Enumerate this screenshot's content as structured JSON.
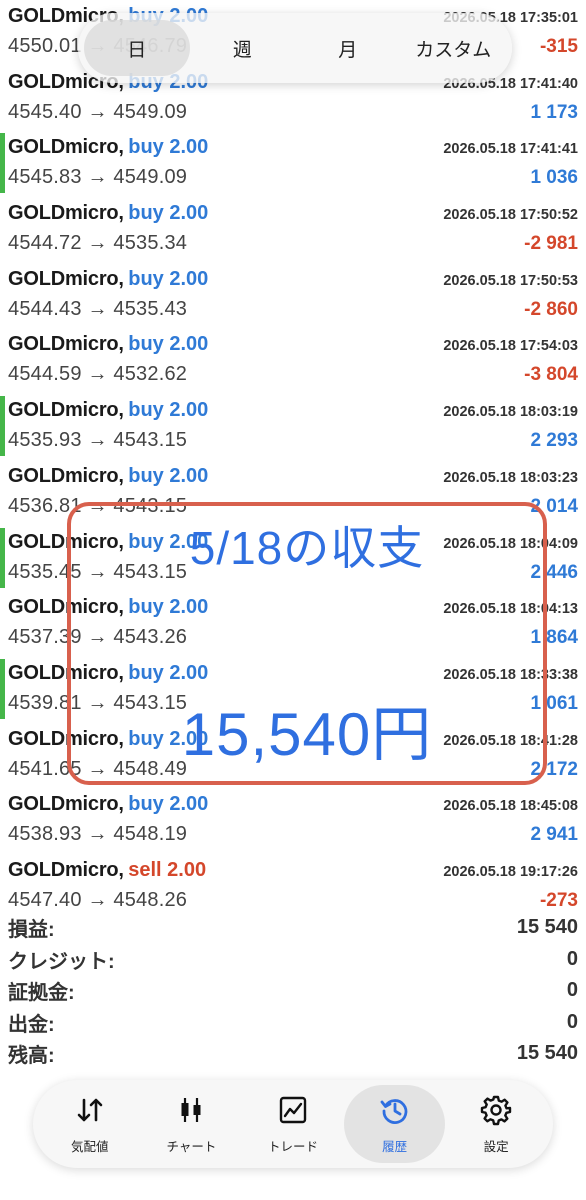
{
  "filter": {
    "tabs": [
      "日",
      "週",
      "月",
      "カスタム"
    ],
    "active_index": 0
  },
  "trades": [
    {
      "symbol": "GOLDmicro,",
      "side": "buy 2.00",
      "side_type": "buy",
      "time": "2026.05.18 17:35:01",
      "prices": "4550.01 → 4546.79",
      "profit": "-315",
      "profit_sign": "neg",
      "marked": false
    },
    {
      "symbol": "GOLDmicro,",
      "side": "buy 2.00",
      "side_type": "buy",
      "time": "2026.05.18 17:41:40",
      "prices": "4545.40 → 4549.09",
      "profit": "1 173",
      "profit_sign": "pos",
      "marked": false
    },
    {
      "symbol": "GOLDmicro,",
      "side": "buy 2.00",
      "side_type": "buy",
      "time": "2026.05.18 17:41:41",
      "prices": "4545.83 → 4549.09",
      "profit": "1 036",
      "profit_sign": "pos",
      "marked": true
    },
    {
      "symbol": "GOLDmicro,",
      "side": "buy 2.00",
      "side_type": "buy",
      "time": "2026.05.18 17:50:52",
      "prices": "4544.72 → 4535.34",
      "profit": "-2 981",
      "profit_sign": "neg",
      "marked": false
    },
    {
      "symbol": "GOLDmicro,",
      "side": "buy 2.00",
      "side_type": "buy",
      "time": "2026.05.18 17:50:53",
      "prices": "4544.43 → 4535.43",
      "profit": "-2 860",
      "profit_sign": "neg",
      "marked": false
    },
    {
      "symbol": "GOLDmicro,",
      "side": "buy 2.00",
      "side_type": "buy",
      "time": "2026.05.18 17:54:03",
      "prices": "4544.59 → 4532.62",
      "profit": "-3 804",
      "profit_sign": "neg",
      "marked": false
    },
    {
      "symbol": "GOLDmicro,",
      "side": "buy 2.00",
      "side_type": "buy",
      "time": "2026.05.18 18:03:19",
      "prices": "4535.93 → 4543.15",
      "profit": "2 293",
      "profit_sign": "pos",
      "marked": true
    },
    {
      "symbol": "GOLDmicro,",
      "side": "buy 2.00",
      "side_type": "buy",
      "time": "2026.05.18 18:03:23",
      "prices": "4536.81 → 4543.15",
      "profit": "2 014",
      "profit_sign": "pos",
      "marked": false
    },
    {
      "symbol": "GOLDmicro,",
      "side": "buy 2.00",
      "side_type": "buy",
      "time": "2026.05.18 18:04:09",
      "prices": "4535.45 → 4543.15",
      "profit": "2 446",
      "profit_sign": "pos",
      "marked": true
    },
    {
      "symbol": "GOLDmicro,",
      "side": "buy 2.00",
      "side_type": "buy",
      "time": "2026.05.18 18:04:13",
      "prices": "4537.39 → 4543.26",
      "profit": "1 864",
      "profit_sign": "pos",
      "marked": false
    },
    {
      "symbol": "GOLDmicro,",
      "side": "buy 2.00",
      "side_type": "buy",
      "time": "2026.05.18 18:33:38",
      "prices": "4539.81 → 4543.15",
      "profit": "1 061",
      "profit_sign": "pos",
      "marked": true
    },
    {
      "symbol": "GOLDmicro,",
      "side": "buy 2.00",
      "side_type": "buy",
      "time": "2026.05.18 18:41:28",
      "prices": "4541.65 → 4548.49",
      "profit": "2 172",
      "profit_sign": "pos",
      "marked": false
    },
    {
      "symbol": "GOLDmicro,",
      "side": "buy 2.00",
      "side_type": "buy",
      "time": "2026.05.18 18:45:08",
      "prices": "4538.93 → 4548.19",
      "profit": "2 941",
      "profit_sign": "pos",
      "marked": false
    },
    {
      "symbol": "GOLDmicro,",
      "side": "sell 2.00",
      "side_type": "sell",
      "time": "2026.05.18 19:17:26",
      "prices": "4547.40 → 4548.26",
      "profit": "-273",
      "profit_sign": "neg",
      "marked": false
    }
  ],
  "summary": [
    {
      "label": "損益:",
      "value": "15 540"
    },
    {
      "label": "クレジット:",
      "value": "0"
    },
    {
      "label": "証拠金:",
      "value": "0"
    },
    {
      "label": "出金:",
      "value": "0"
    },
    {
      "label": "残高:",
      "value": "15 540"
    }
  ],
  "overlay": {
    "title": "5/18の収支",
    "amount": "15,540円"
  },
  "navbar": {
    "items": [
      {
        "label": "気配値",
        "icon": "quotes-arrows-icon"
      },
      {
        "label": "チャート",
        "icon": "candlestick-chart-icon"
      },
      {
        "label": "トレード",
        "icon": "trade-line-chart-icon"
      },
      {
        "label": "履歴",
        "icon": "history-clock-icon"
      },
      {
        "label": "設定",
        "icon": "gear-icon"
      }
    ],
    "active_index": 3
  },
  "colors": {
    "buy": "#2f7ad6",
    "sell": "#d4472b",
    "profit_positive": "#2f7ad6",
    "profit_negative": "#d4472b",
    "marker": "#45b649",
    "overlay_border": "#d8604d",
    "overlay_text": "#2f6fe0"
  }
}
